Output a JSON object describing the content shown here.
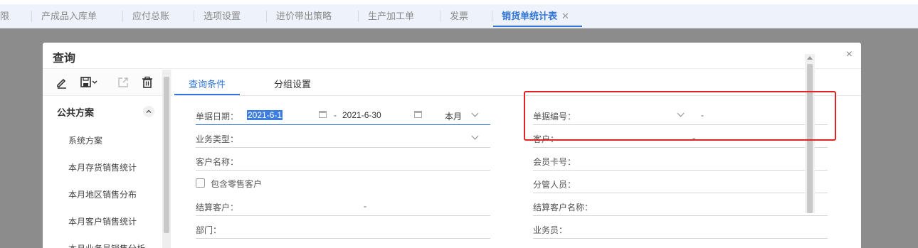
{
  "tabs": [
    {
      "label": "限"
    },
    {
      "label": "产成品入库单"
    },
    {
      "label": "应付总账"
    },
    {
      "label": "选项设置"
    },
    {
      "label": "进价带出策略"
    },
    {
      "label": "生产加工单"
    },
    {
      "label": "发票"
    },
    {
      "label": "销货单统计表",
      "active": true
    }
  ],
  "tab_close": "✕",
  "modal": {
    "title": "查询",
    "close": "×"
  },
  "toolbar_icons": [
    "edit-icon",
    "save-icon",
    "export-icon",
    "delete-icon"
  ],
  "schemes": {
    "group_title": "公共方案",
    "items": [
      "系统方案",
      "本月存货销售统计",
      "本月地区销售分布",
      "本月客户销售统计",
      "本月业务员销售分析"
    ]
  },
  "content_tabs": [
    "查询条件",
    "分组设置"
  ],
  "form": {
    "date_label": "单据日期：",
    "date_from": "2021-6-1",
    "date_sep": "-",
    "date_to": "2021-6-30",
    "period": "本月",
    "biz_type_label": "业务类型：",
    "customer_name_label": "客户名称：",
    "include_retail_label": "包含零售客户",
    "settle_customer_label": "结算客户：",
    "settle_customer_sep": "-",
    "dept_label": "部门：",
    "doc_no_label": "单据编号：",
    "doc_no_sep": "-",
    "customer_label": "客户：",
    "customer_sep": "-",
    "member_card_label": "会员卡号：",
    "manager_label": "分管人员：",
    "settle_customer_name_label": "结算客户名称：",
    "salesperson_label": "业务员："
  },
  "colors": {
    "accent": "#2f74d6",
    "highlight_border": "#e02424"
  }
}
